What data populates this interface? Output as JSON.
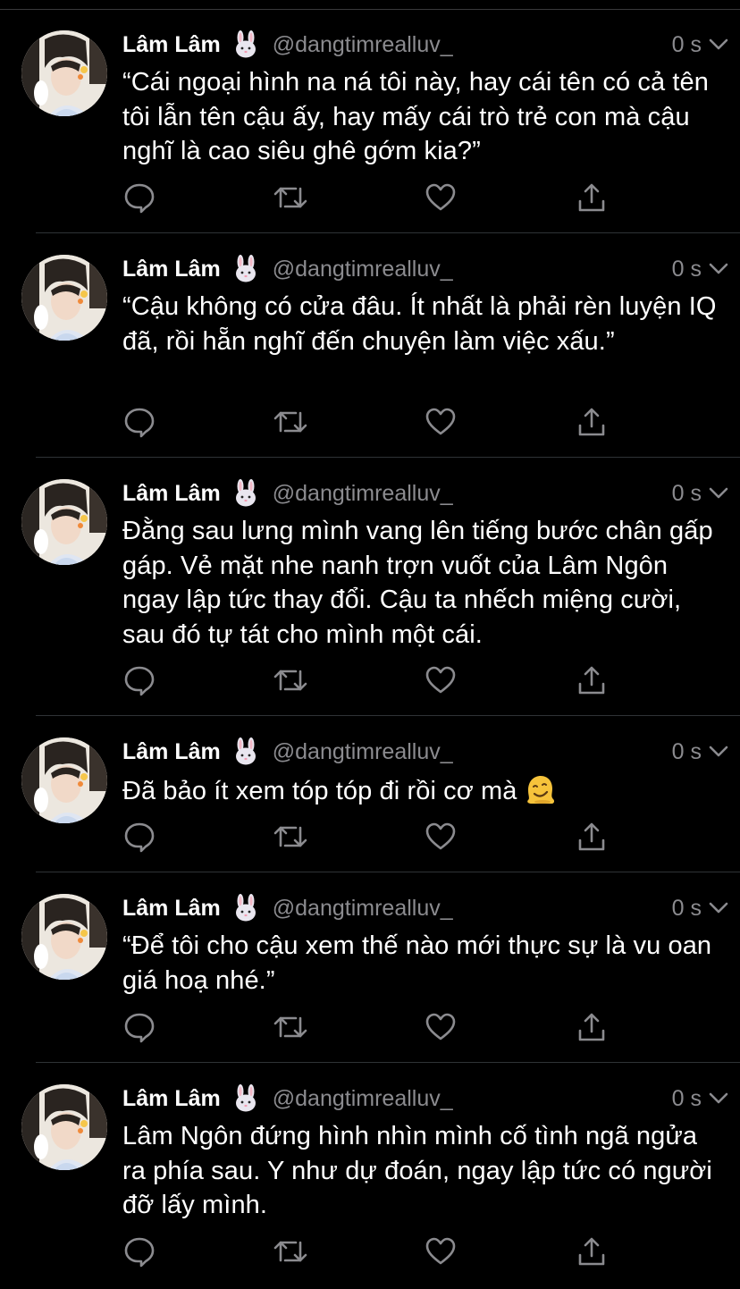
{
  "tweets": [
    {
      "name": "Lâm Lâm",
      "handle": "@dangtimrealluv_",
      "time": "0 s",
      "text": "“Cái ngoại hình na ná tôi này, hay cái tên có cả tên tôi lẫn tên cậu ấy, hay mấy cái trò trẻ con mà cậu nghĩ là cao siêu ghê gớm kia?”"
    },
    {
      "name": "Lâm Lâm",
      "handle": "@dangtimrealluv_",
      "time": "0 s",
      "text": "“Cậu không có cửa đâu. Ít nhất là phải rèn luyện IQ đã, rồi hẵn nghĩ đến chuyện làm việc xấu.”"
    },
    {
      "name": "Lâm Lâm",
      "handle": "@dangtimrealluv_",
      "time": "0 s",
      "text": "Đằng sau lưng mình vang lên tiếng bước chân gấp gáp. Vẻ mặt nhe nanh trợn vuốt của Lâm Ngôn ngay lập tức thay đổi. Cậu ta nhếch miệng cười, sau đó tự tát cho mình một cái."
    },
    {
      "name": "Lâm Lâm",
      "handle": "@dangtimrealluv_",
      "time": "0 s",
      "text": "Đã bảo ít xem tóp tóp đi rồi cơ mà"
    },
    {
      "name": "Lâm Lâm",
      "handle": "@dangtimrealluv_",
      "time": "0 s",
      "text": "“Để tôi cho cậu xem thế nào mới thực sự là vu oan giá hoạ nhé.”"
    },
    {
      "name": "Lâm Lâm",
      "handle": "@dangtimrealluv_",
      "time": "0 s",
      "text": "Lâm Ngôn đứng hình nhìn mình cố tình ngã ngửa ra phía sau. Y như dự đoán, ngay lập tức có người đỡ lấy mình."
    }
  ],
  "icons": {
    "name_emoji": "rabbit-face-icon",
    "tweet4_emoji": "melting-face-icon",
    "menu": "chevron-down-icon",
    "reply": "reply-icon",
    "retweet": "retweet-icon",
    "like": "heart-icon",
    "share": "share-icon"
  },
  "colors": {
    "background": "#000000",
    "primary_text": "#ffffff",
    "secondary_text": "#8b8b8f",
    "divider": "#2f3336"
  }
}
